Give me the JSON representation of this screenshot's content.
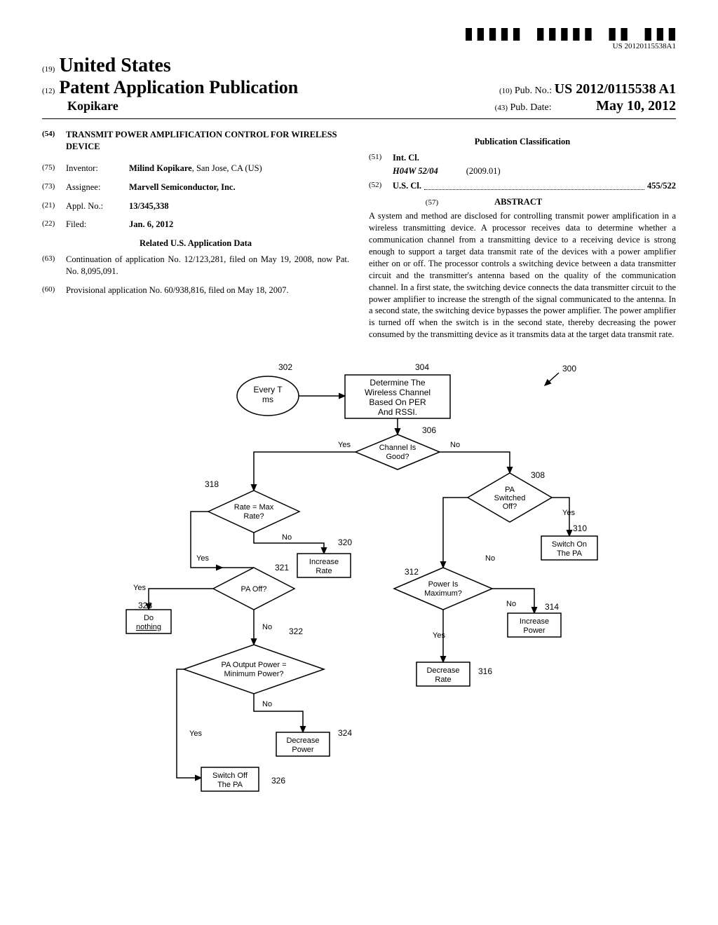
{
  "barcode_label": "US 20120115538A1",
  "header": {
    "num19": "(19)",
    "country": "United States",
    "num12": "(12)",
    "pub_type": "Patent Application Publication",
    "author": "Kopikare",
    "num10": "(10)",
    "pubno_label": "Pub. No.:",
    "pubno": "US 2012/0115538 A1",
    "num43": "(43)",
    "pubdate_label": "Pub. Date:",
    "pubdate": "May 10, 2012"
  },
  "left": {
    "n54": "(54)",
    "title": "TRANSMIT POWER AMPLIFICATION CONTROL FOR WIRELESS DEVICE",
    "n75": "(75)",
    "inventor_label": "Inventor:",
    "inventor": "Milind Kopikare",
    "inventor_loc": ", San Jose, CA (US)",
    "n73": "(73)",
    "assignee_label": "Assignee:",
    "assignee": "Marvell Semiconductor, Inc.",
    "n21": "(21)",
    "applno_label": "Appl. No.:",
    "applno": "13/345,338",
    "n22": "(22)",
    "filed_label": "Filed:",
    "filed": "Jan. 6, 2012",
    "related_head": "Related U.S. Application Data",
    "n63": "(63)",
    "continuation": "Continuation of application No. 12/123,281, filed on May 19, 2008, now Pat. No. 8,095,091.",
    "n60": "(60)",
    "provisional": "Provisional application No. 60/938,816, filed on May 18, 2007."
  },
  "right": {
    "class_head": "Publication Classification",
    "n51": "(51)",
    "intcl_label": "Int. Cl.",
    "intcl_code": "H04W 52/04",
    "intcl_year": "(2009.01)",
    "n52": "(52)",
    "uscl_label": "U.S. Cl.",
    "uscl_val": "455/522",
    "n57": "(57)",
    "abstract_label": "ABSTRACT",
    "abstract": "A system and method are disclosed for controlling transmit power amplification in a wireless transmitting device. A processor receives data to determine whether a communication channel from a transmitting device to a receiving device is strong enough to support a target data transmit rate of the devices with a power amplifier either on or off. The processor controls a switching device between a data transmitter circuit and the transmitter's antenna based on the quality of the communication channel. In a first state, the switching device connects the data transmitter circuit to the power amplifier to increase the strength of the signal communicated to the antenna. In a second state, the switching device bypasses the power amplifier. The power amplifier is turned off when the switch is in the second state, thereby decreasing the power consumed by the transmitting device as it transmits data at the target data transmit rate."
  },
  "flow": {
    "ref300": "300",
    "n302": "302",
    "b302a": "Every T",
    "b302b": "ms",
    "n304": "304",
    "b304a": "Determine The",
    "b304b": "Wireless Channel",
    "b304c": "Based On PER",
    "b304d": "And RSSI.",
    "n306": "306",
    "d306a": "Channel Is",
    "d306b": "Good?",
    "n308": "308",
    "d308a": "PA",
    "d308b": "Switched",
    "d308c": "Off?",
    "n310": "310",
    "b310a": "Switch On",
    "b310b": "The PA",
    "n312": "312",
    "d312a": "Power Is",
    "d312b": "Maximum?",
    "n314": "314",
    "b314a": "Increase",
    "b314b": "Power",
    "n316": "316",
    "b316a": "Decrease",
    "b316b": "Rate",
    "n318": "318",
    "d318a": "Rate = Max",
    "d318b": "Rate?",
    "n320": "320",
    "b320a": "Increase",
    "b320b": "Rate",
    "n321": "321",
    "d321": "PA Off?",
    "n322": "322",
    "d322a": "PA Output Power =",
    "d322b": "Minimum Power?",
    "n323": "323",
    "b323a": "Do",
    "b323b": "nothing",
    "n324": "324",
    "b324a": "Decrease",
    "b324b": "Power",
    "n326": "326",
    "b326a": "Switch Off",
    "b326b": "The PA",
    "yes": "Yes",
    "no": "No"
  }
}
